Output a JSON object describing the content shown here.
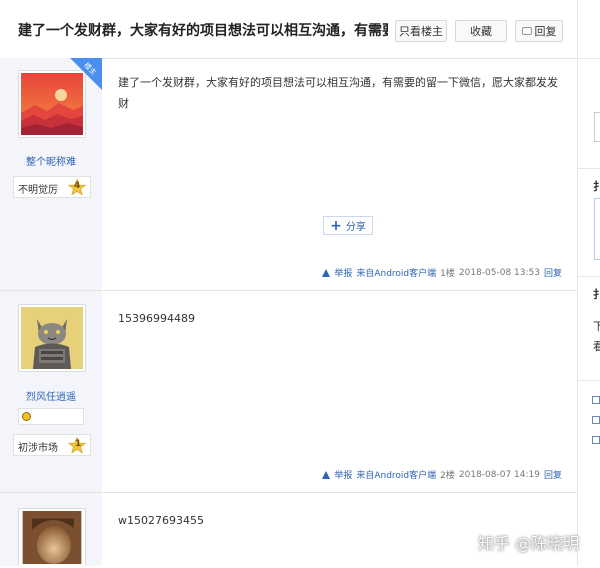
{
  "thread": {
    "title": "建了一个发财群，大家有好的项目想法可以相互沟通，有需要的留.",
    "btn_only_op": "只看楼主",
    "btn_favorite": "收藏",
    "btn_reply": "回复"
  },
  "posts": [
    {
      "username": "整个昵称难",
      "level_name": "不明觉厉",
      "level": "4",
      "op_tag": "楼主",
      "content": "建了一个发财群，大家有好的项目想法可以相互沟通，有需要的留一下微信，愿大家都发发财",
      "share_label": "分享",
      "report": "举报",
      "source": "来自Android客户端",
      "floor": "1楼",
      "time": "2018-05-08 13:53",
      "reply": "回复"
    },
    {
      "username": "烈风任逍遥",
      "level_name": "初涉市场",
      "level": "1",
      "content": "15396994489",
      "report": "举报",
      "source": "来自Android客户端",
      "floor": "2楼",
      "time": "2018-08-07 14:19",
      "reply": "回复"
    },
    {
      "content": "w15027693455"
    }
  ],
  "side_panel": {
    "label_1": "扌",
    "label_2": "扌",
    "text_1": "下",
    "text_2": "看"
  },
  "watermark": "知乎 @陈晓明",
  "colors": {
    "link": "#2d64b3",
    "op_tag": "#4a8ff0",
    "author_bg": "#f3f5fa",
    "level_star": "#f4c53a"
  }
}
